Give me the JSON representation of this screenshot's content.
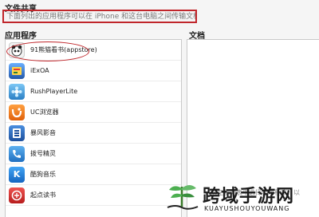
{
  "header": {
    "section_title": "文件共享",
    "description": "下面列出的应用程序可以在 iPhone 和这台电脑之间传输文档。"
  },
  "apps": {
    "title": "应用程序",
    "items": [
      {
        "name": "91熊猫看书(appstore)",
        "icon": "panda-reader-icon",
        "color": "#f0f0f0",
        "glyph": "◉"
      },
      {
        "name": "iExOA",
        "icon": "iexoa-icon",
        "color": "#3a7bd5",
        "glyph": "▦"
      },
      {
        "name": "RushPlayerLite",
        "icon": "rushplayer-icon",
        "color": "#3aa0e0",
        "glyph": "✿"
      },
      {
        "name": "UC浏览器",
        "icon": "uc-browser-icon",
        "color": "#f07a1a",
        "glyph": "U"
      },
      {
        "name": "暴风影音",
        "icon": "baofeng-icon",
        "color": "#2a6fc9",
        "glyph": "▤"
      },
      {
        "name": "拨号精灵",
        "icon": "dialer-icon",
        "color": "#2e86d6",
        "glyph": "☎"
      },
      {
        "name": "酷狗音乐",
        "icon": "kugou-icon",
        "color": "#1e88e5",
        "glyph": "K"
      },
      {
        "name": "起点读书",
        "icon": "qidian-icon",
        "color": "#e53935",
        "glyph": "起"
      }
    ]
  },
  "documents": {
    "title": "文档",
    "hint": "从左侧列表中选择应用程序，以"
  },
  "watermark": {
    "title": "跨域手游网",
    "subtitle": "KUAYUSHOUYOUWANG"
  },
  "colors": {
    "highlight": "#c0262b"
  }
}
